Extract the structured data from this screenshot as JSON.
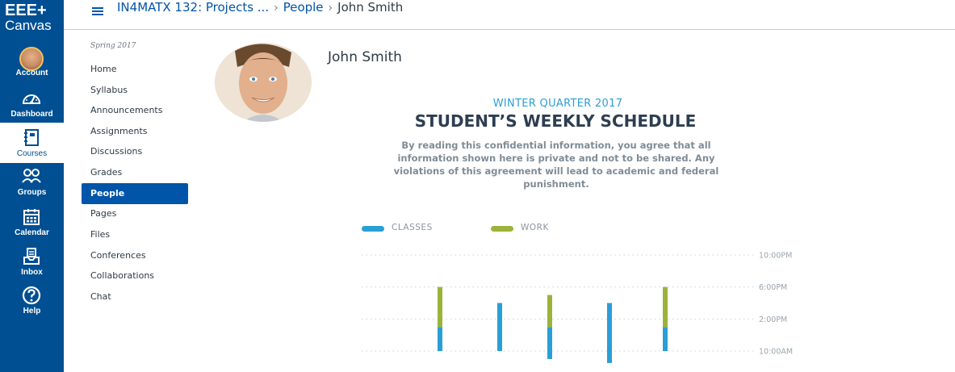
{
  "brand": {
    "line1": "EEE+",
    "line2": "Canvas"
  },
  "global_nav": [
    {
      "key": "account",
      "label": "Account",
      "icon": "avatar"
    },
    {
      "key": "dashboard",
      "label": "Dashboard",
      "icon": "dashboard-icon"
    },
    {
      "key": "courses",
      "label": "Courses",
      "icon": "courses-icon",
      "active": true
    },
    {
      "key": "groups",
      "label": "Groups",
      "icon": "groups-icon"
    },
    {
      "key": "calendar",
      "label": "Calendar",
      "icon": "calendar-icon"
    },
    {
      "key": "inbox",
      "label": "Inbox",
      "icon": "inbox-icon"
    },
    {
      "key": "help",
      "label": "Help",
      "icon": "help-icon"
    }
  ],
  "breadcrumb": {
    "course": "IN4MATX 132: Projects ...",
    "section": "People",
    "current": "John Smith",
    "separator": "›"
  },
  "course_nav": {
    "term": "Spring 2017",
    "items": [
      "Home",
      "Syllabus",
      "Announcements",
      "Assignments",
      "Discussions",
      "Grades",
      "People",
      "Pages",
      "Files",
      "Conferences",
      "Collaborations",
      "Chat"
    ],
    "active": "People"
  },
  "profile": {
    "name": "John Smith"
  },
  "schedule": {
    "subtitle": "WINTER QUARTER 2017",
    "title": "STUDENT’S WEEKLY SCHEDULE",
    "notice": "By reading this confidential information, you agree that all information shown here is private and not to be shared. Any violations of this agreement will lead to academic and federal punishment."
  },
  "colors": {
    "nav_bg": "#004f92",
    "link": "#0055a8",
    "classes": "#2a9fd6",
    "work": "#9bb33a"
  },
  "chart_data": {
    "type": "bar",
    "legend": [
      {
        "name": "CLASSES",
        "color": "#2a9fd6"
      },
      {
        "name": "WORK",
        "color": "#9bb33a"
      }
    ],
    "y_ticks": [
      "10:00PM",
      "6:00PM",
      "2:00PM",
      "10:00AM"
    ],
    "y_tick_hours": [
      22,
      18,
      14,
      10
    ],
    "grid": true,
    "columns": [
      {
        "segments": [
          {
            "series": "CLASSES",
            "start": 10.0,
            "end": 13.0
          },
          {
            "series": "WORK",
            "start": 13.0,
            "end": 18.0
          }
        ]
      },
      {
        "segments": [
          {
            "series": "CLASSES",
            "start": 10.0,
            "end": 16.0
          }
        ]
      },
      {
        "segments": [
          {
            "series": "CLASSES",
            "start": 9.0,
            "end": 13.0
          },
          {
            "series": "WORK",
            "start": 13.0,
            "end": 17.0
          }
        ]
      },
      {
        "segments": [
          {
            "series": "CLASSES",
            "start": 8.5,
            "end": 16.0
          }
        ]
      },
      {
        "segments": [
          {
            "series": "CLASSES",
            "start": 10.0,
            "end": 13.0
          },
          {
            "series": "WORK",
            "start": 13.0,
            "end": 18.0
          }
        ]
      }
    ]
  }
}
